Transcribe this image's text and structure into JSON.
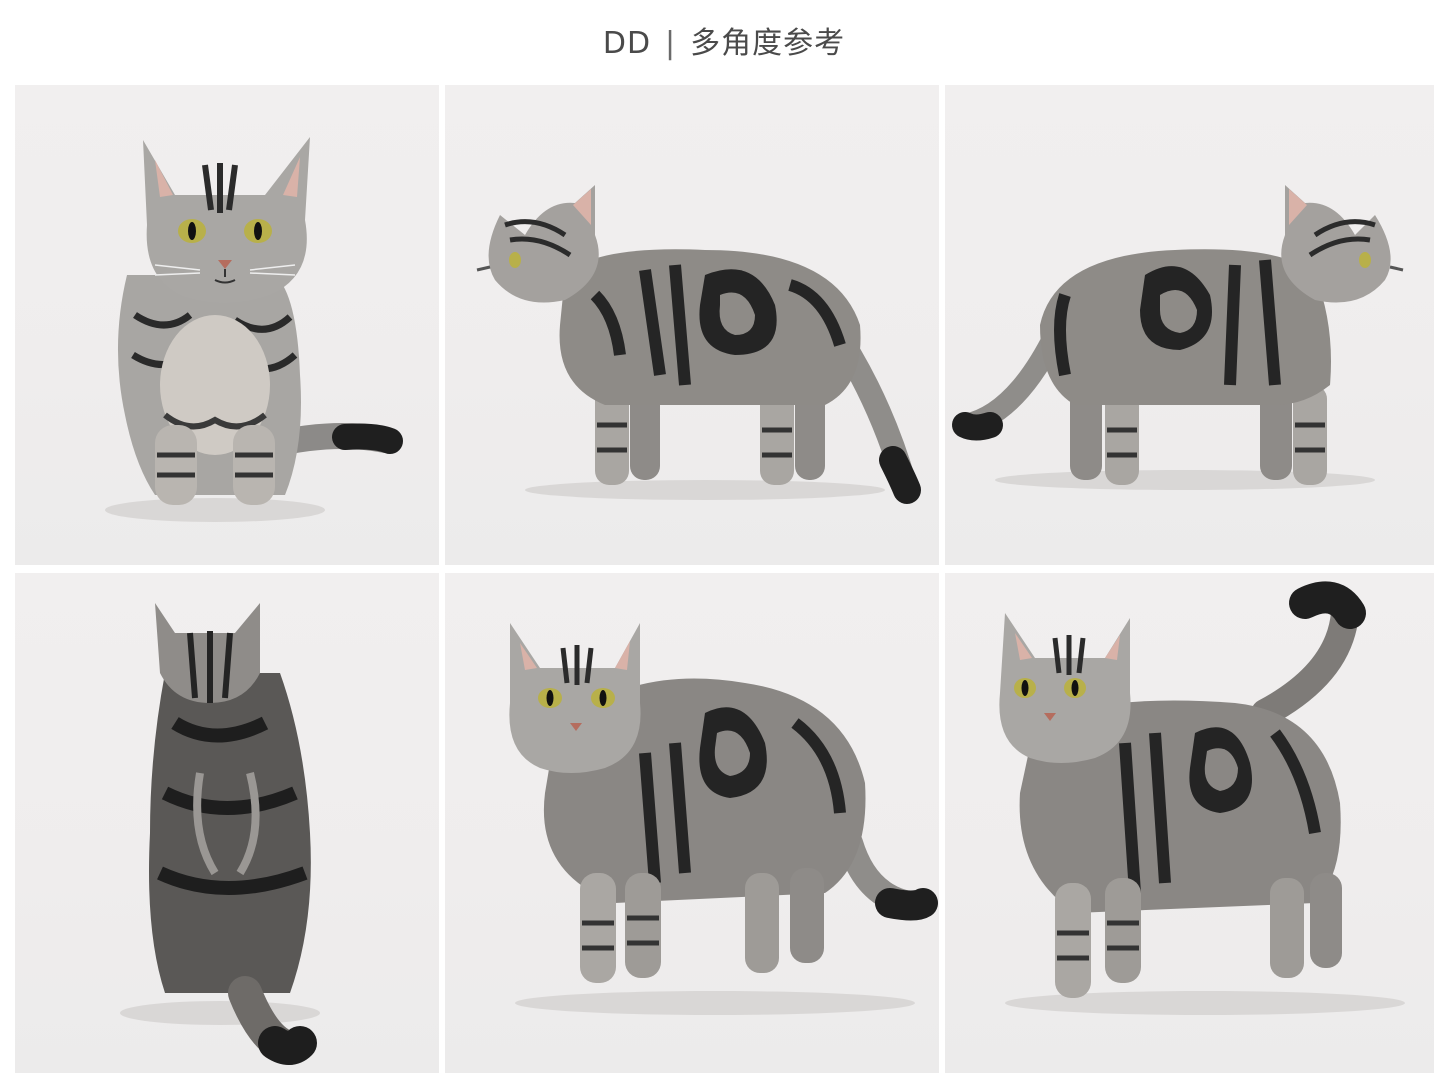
{
  "title": {
    "left": "DD",
    "separator": "|",
    "right": "多角度参考"
  },
  "panels": [
    {
      "view": "front-sitting"
    },
    {
      "view": "left-side-standing"
    },
    {
      "view": "right-side-standing"
    },
    {
      "view": "back-sitting"
    },
    {
      "view": "three-quarter-front-standing"
    },
    {
      "view": "three-quarter-front-tail-up"
    }
  ],
  "colors": {
    "background": "#ffffff",
    "panel": "#efeded",
    "fur_light": "#a9a7a5",
    "fur_dark": "#2b2b2b",
    "eye": "#b8b04a"
  }
}
